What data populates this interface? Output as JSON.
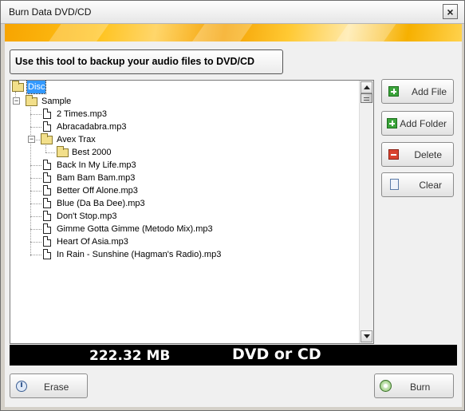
{
  "window": {
    "title": "Burn Data DVD/CD"
  },
  "heading": "Use this tool to backup your audio files to DVD/CD",
  "tree": {
    "root": "Disc",
    "sample": "Sample",
    "sample_files_top": [
      "2 Times.mp3",
      "Abracadabra.mp3"
    ],
    "subfolder": "Avex Trax",
    "subsubfolder": "Best 2000",
    "sample_files_bottom": [
      "Back In My Life.mp3",
      "Bam Bam Bam.mp3",
      "Better Off Alone.mp3",
      "Blue (Da Ba Dee).mp3",
      "Don't Stop.mp3",
      "Gimme Gotta Gimme (Metodo Mix).mp3",
      "Heart Of Asia.mp3",
      "In Rain - Sunshine (Hagman's Radio).mp3"
    ]
  },
  "buttons": {
    "add_file": "Add File",
    "add_folder": "Add Folder",
    "delete": "Delete",
    "clear": "Clear",
    "erase": "Erase",
    "burn": "Burn"
  },
  "status": {
    "size": "222.32 MB",
    "media": "DVD or CD"
  },
  "icons": {
    "close": "close-icon",
    "add_file": "plus-icon",
    "add_folder": "plus-icon",
    "delete": "minus-icon",
    "clear": "documents-icon",
    "erase": "disc-erase-icon",
    "burn": "disc-burn-icon"
  },
  "colors": {
    "selection": "#3399ff",
    "banner": "#f7a400",
    "status_bg": "#000000"
  }
}
